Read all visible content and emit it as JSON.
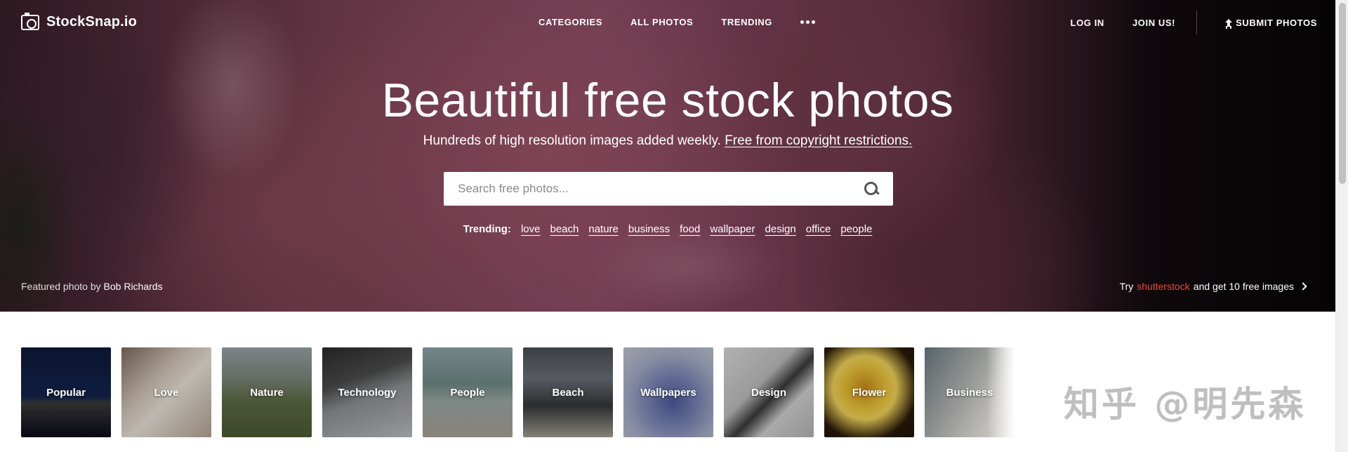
{
  "brand": {
    "name": "StockSnap.io"
  },
  "nav": {
    "categories": "CATEGORIES",
    "all_photos": "ALL PHOTOS",
    "trending": "TRENDING",
    "login": "LOG IN",
    "join": "JOIN US!",
    "submit": "SUBMIT PHOTOS"
  },
  "hero": {
    "title": "Beautiful free stock photos",
    "subtitle": "Hundreds of high resolution images added weekly.",
    "subtitle_link": "Free from copyright restrictions."
  },
  "search": {
    "placeholder": "Search free photos..."
  },
  "trending": {
    "label": "Trending:",
    "tags": [
      "love",
      "beach",
      "nature",
      "business",
      "food",
      "wallpaper",
      "design",
      "office",
      "people"
    ]
  },
  "credit": {
    "prefix": "Featured photo by",
    "author": "Bob Richards"
  },
  "promo": {
    "prefix": "Try",
    "brand": "shutterstock",
    "suffix": "and get 10 free images"
  },
  "categories": [
    "Popular",
    "Love",
    "Nature",
    "Technology",
    "People",
    "Beach",
    "Wallpapers",
    "Design",
    "Flower",
    "Business"
  ],
  "watermark": "知乎 @明先森",
  "colors": {
    "promo_brand": "#f2462e",
    "background": "#ffffff"
  }
}
